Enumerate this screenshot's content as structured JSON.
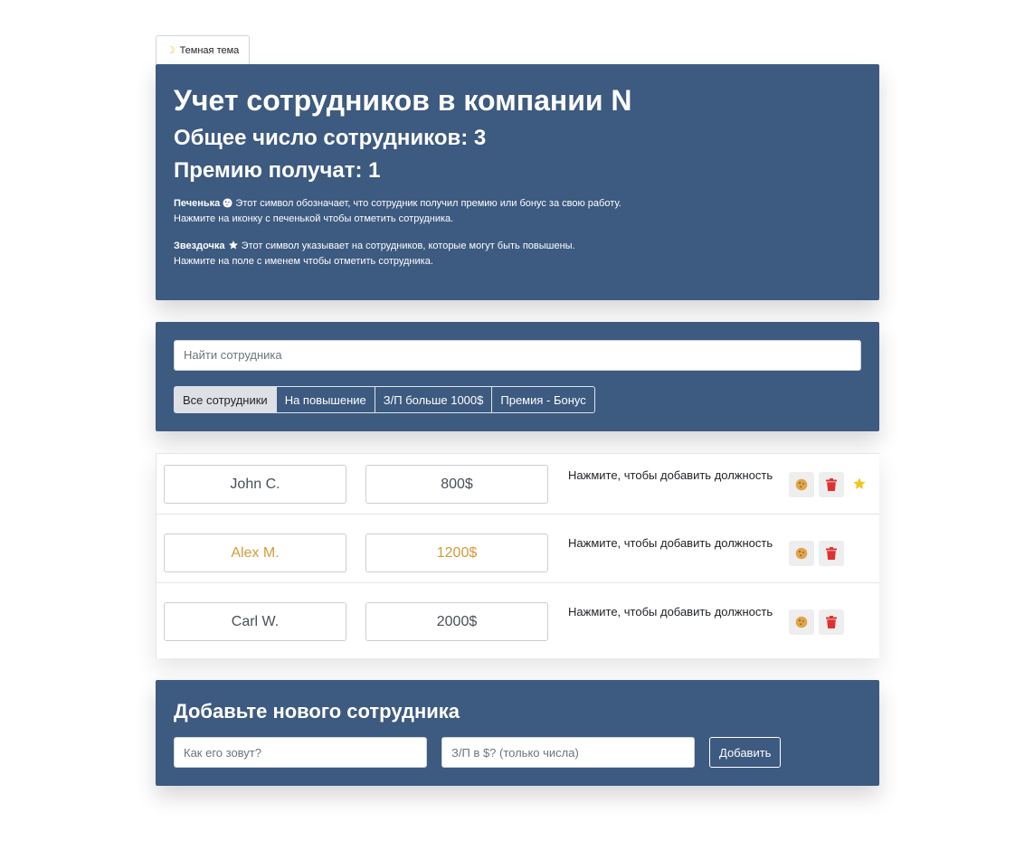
{
  "theme_toggle": {
    "icon": "moon-icon",
    "label": "Темная тема"
  },
  "header": {
    "title": "Учет сотрудников в компании N",
    "total": "Общее число сотрудников: 3",
    "bonus": "Премию получат: 1",
    "legend_cookie": {
      "name": "Печенька",
      "text": "Этот символ обозначает, что сотрудник получил премию или бонус за свою работу.",
      "hint": "Нажмите на иконку с печенькой чтобы отметить сотрудника."
    },
    "legend_star": {
      "name": "Звездочка",
      "text": "Этот символ указывает на сотрудников, которые могут быть повышены.",
      "hint": "Нажмите на поле с именем чтобы отметить сотрудника."
    }
  },
  "search": {
    "placeholder": "Найти сотрудника"
  },
  "filters": [
    {
      "label": "Все сотрудники",
      "active": true
    },
    {
      "label": "На повышение",
      "active": false
    },
    {
      "label": "З/П больше 1000$",
      "active": false
    },
    {
      "label": "Премия - Бонус",
      "active": false
    }
  ],
  "employees": [
    {
      "name": "John C.",
      "salary": "800$",
      "position": "Нажмите, чтобы добавить должность",
      "bonus": false,
      "promote": true
    },
    {
      "name": "Alex M.",
      "salary": "1200$",
      "position": "Нажмите, чтобы добавить должность",
      "bonus": true,
      "promote": false
    },
    {
      "name": "Carl W.",
      "salary": "2000$",
      "position": "Нажмите, чтобы добавить должность",
      "bonus": false,
      "promote": false
    }
  ],
  "add_form": {
    "title": "Добавьте нового сотрудника",
    "name_placeholder": "Как его зовут?",
    "salary_placeholder": "З/П в $? (только числа)",
    "submit_label": "Добавить"
  },
  "colors": {
    "panel": "#3d5a80",
    "bonus_text": "#d49a3a",
    "cookie": "#e0a44a",
    "trash": "#e03131",
    "star": "#f5c518"
  }
}
